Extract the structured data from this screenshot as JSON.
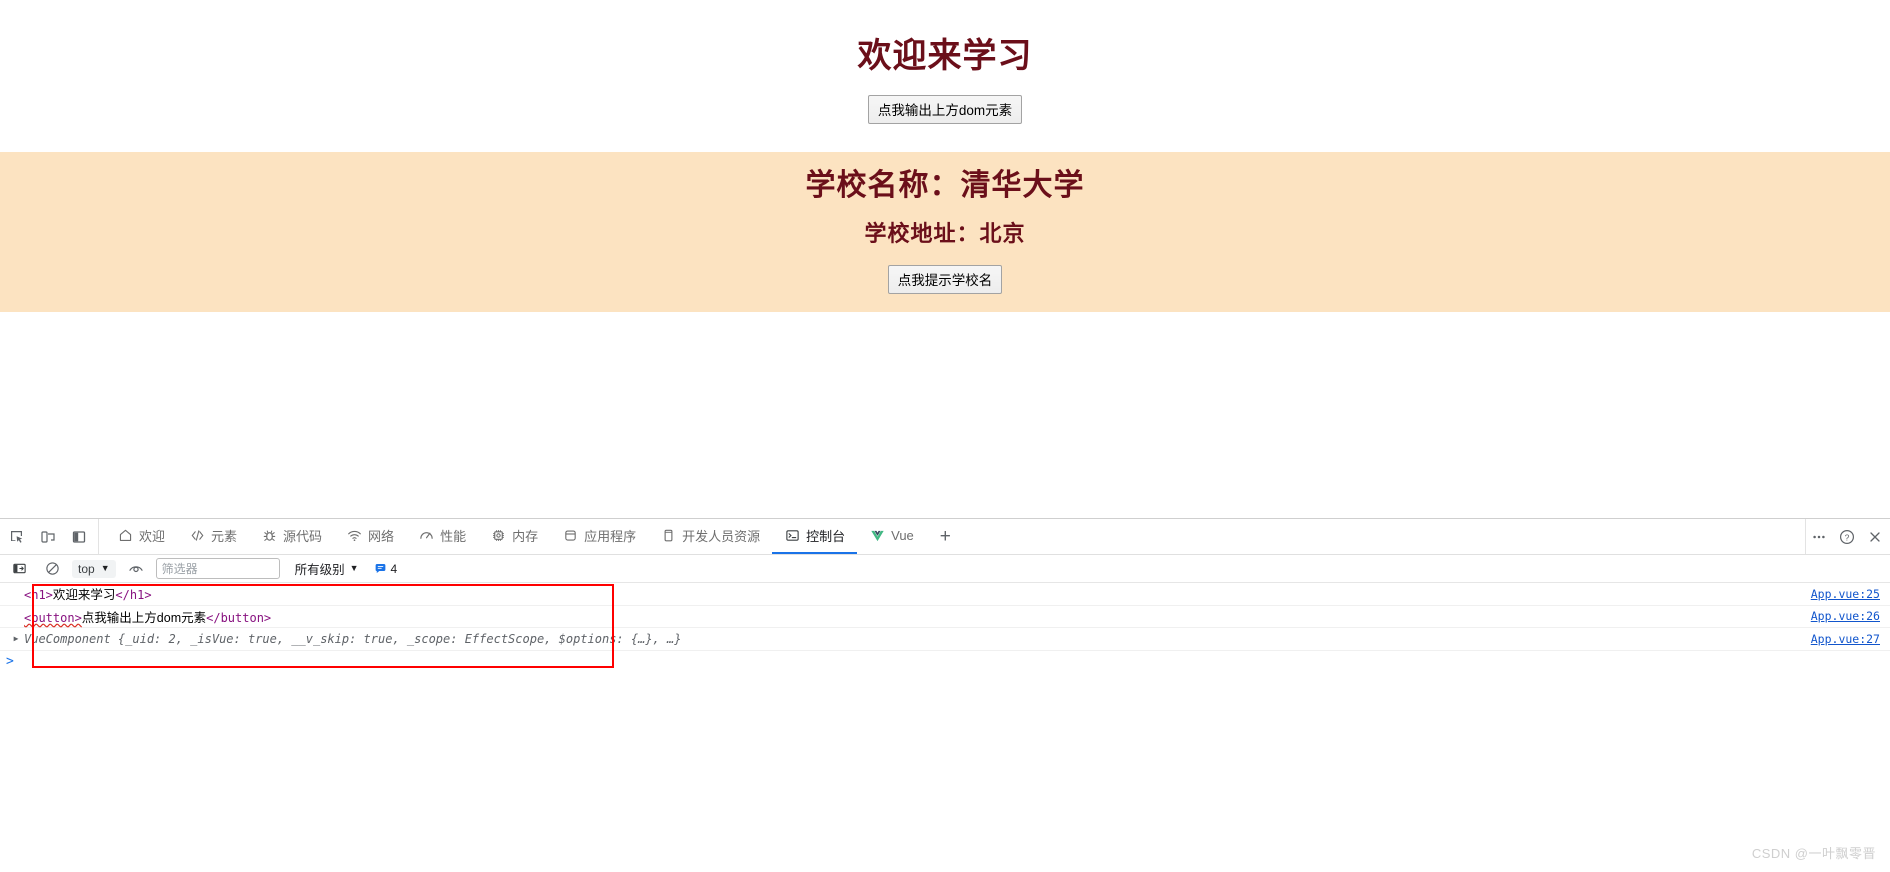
{
  "page": {
    "title": "欢迎来学习",
    "dom_button_label": "点我输出上方dom元素",
    "school_name_line": "学校名称：清华大学",
    "school_address_line": "学校地址：北京",
    "school_button_label": "点我提示学校名",
    "title_color": "#6b0f1a",
    "band_color": "#fce3c1"
  },
  "devtools": {
    "tabs": [
      {
        "label": "欢迎",
        "icon": "home-icon",
        "active": false
      },
      {
        "label": "元素",
        "icon": "code-icon",
        "active": false
      },
      {
        "label": "源代码",
        "icon": "bug-icon",
        "active": false
      },
      {
        "label": "网络",
        "icon": "wifi-icon",
        "active": false
      },
      {
        "label": "性能",
        "icon": "gauge-icon",
        "active": false
      },
      {
        "label": "内存",
        "icon": "chip-icon",
        "active": false
      },
      {
        "label": "应用程序",
        "icon": "database-icon",
        "active": false
      },
      {
        "label": "开发人员资源",
        "icon": "device-icon",
        "active": false
      },
      {
        "label": "控制台",
        "icon": "console-icon",
        "active": true
      },
      {
        "label": "Vue",
        "icon": "vue-logo-icon",
        "active": false
      }
    ],
    "add_tab_label": "+",
    "left_icons": [
      "inspect-element-icon",
      "device-toolbar-icon",
      "dock-side-icon"
    ],
    "right_icons": [
      "more-options-icon",
      "help-icon",
      "close-icon"
    ],
    "console_toolbar": {
      "sidebar_toggle": "console-sidebar-icon",
      "clear_label": "clear-console-icon",
      "context": "top",
      "eye_icon": "live-expression-icon",
      "filter_placeholder": "筛选器",
      "filter_value": "",
      "level": "所有级别",
      "message_count": "4"
    },
    "console_rows": [
      {
        "kind": "html",
        "open_tag": "<h1>",
        "text": "欢迎来学习",
        "close_tag": "</h1>",
        "source": "App.vue:25",
        "expandable": false,
        "tag_underlined": false
      },
      {
        "kind": "html",
        "open_tag": "<button>",
        "text": "点我输出上方dom元素",
        "close_tag": "</button>",
        "source": "App.vue:26",
        "expandable": false,
        "tag_underlined": true
      },
      {
        "kind": "object",
        "text": "VueComponent {_uid: 2, _isVue: true, __v_skip: true, _scope: EffectScope, $options: {…}, …}",
        "source": "App.vue:27",
        "expandable": true,
        "tag_underlined": false
      }
    ],
    "prompt_symbol": ">"
  },
  "watermark": "CSDN @一叶飘零晋"
}
